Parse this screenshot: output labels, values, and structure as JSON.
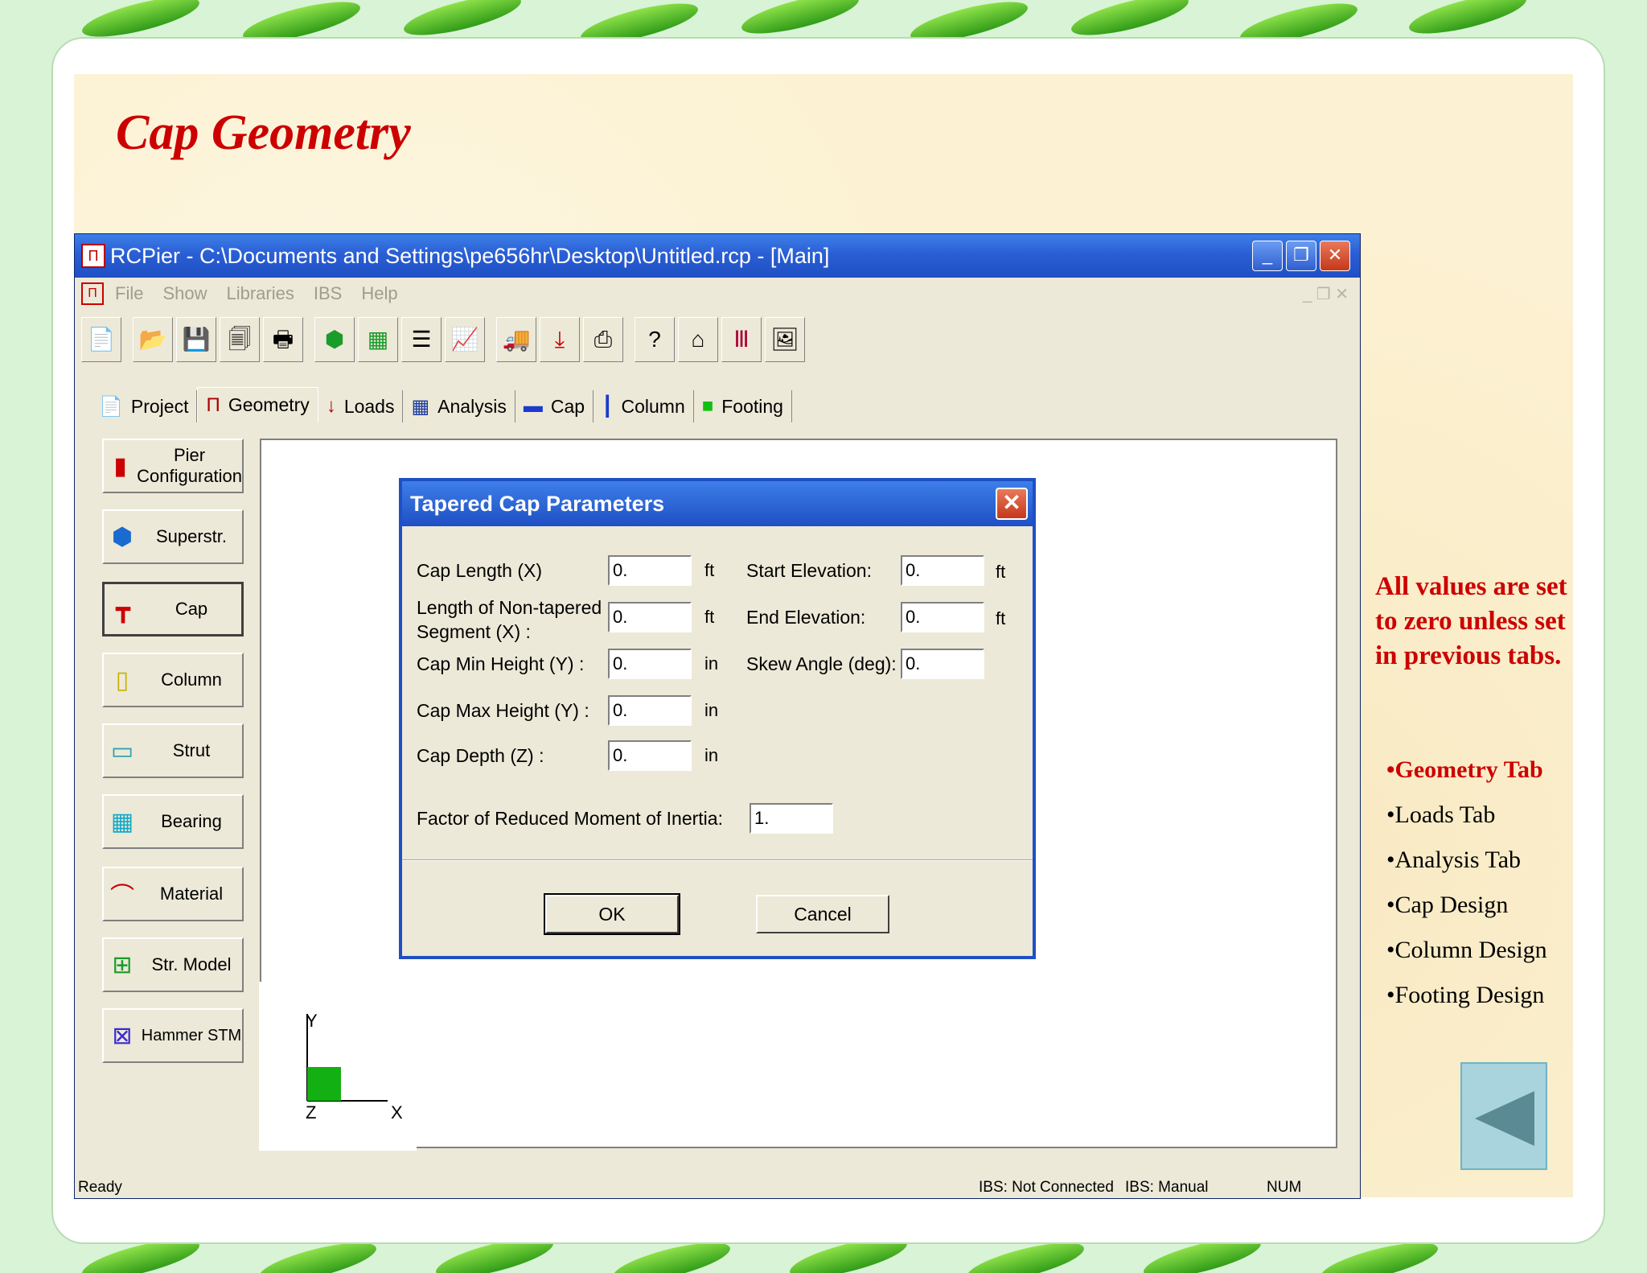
{
  "slide": {
    "title": "Cap Geometry",
    "notes": "All values are set to zero unless set in previous tabs.",
    "bullets": [
      {
        "label": "•Geometry Tab",
        "active": true
      },
      {
        "label": "•Loads Tab",
        "active": false
      },
      {
        "label": "•Analysis Tab",
        "active": false
      },
      {
        "label": "•Cap Design",
        "active": false
      },
      {
        "label": "•Column Design",
        "active": false
      },
      {
        "label": "•Footing Design",
        "active": false
      }
    ]
  },
  "window": {
    "title": "RCPier - C:\\Documents and Settings\\pe656hr\\Desktop\\Untitled.rcp - [Main]",
    "menu": [
      "File",
      "Show",
      "Libraries",
      "IBS",
      "Help"
    ],
    "tabs": [
      {
        "label": "Project",
        "icon": "doc-icon"
      },
      {
        "label": "Geometry",
        "icon": "frame-icon"
      },
      {
        "label": "Loads",
        "icon": "arrow-down-icon"
      },
      {
        "label": "Analysis",
        "icon": "grid-icon"
      },
      {
        "label": "Cap",
        "icon": "cap-bar-icon"
      },
      {
        "label": "Column",
        "icon": "column-icon"
      },
      {
        "label": "Footing",
        "icon": "footing-icon"
      }
    ],
    "sidebar": [
      {
        "label": "Pier Configuration",
        "icon": "pier-config-icon"
      },
      {
        "label": "Superstr.",
        "icon": "superstructure-icon"
      },
      {
        "label": "Cap",
        "icon": "hammer-icon"
      },
      {
        "label": "Column",
        "icon": "column-icon"
      },
      {
        "label": "Strut",
        "icon": "strut-icon"
      },
      {
        "label": "Bearing",
        "icon": "bearing-icon"
      },
      {
        "label": "Material",
        "icon": "material-curve-icon"
      },
      {
        "label": "Str. Model",
        "icon": "str-model-icon"
      },
      {
        "label": "Hammer STM",
        "icon": "hammer-stm-icon"
      }
    ],
    "status": {
      "left": "Ready",
      "ibs_conn": "IBS: Not Connected",
      "ibs_mode": "IBS: Manual",
      "num": "NUM"
    },
    "axes": {
      "y": "Y",
      "z": "Z",
      "x": "X"
    }
  },
  "dialog": {
    "title": "Tapered Cap Parameters",
    "fields": {
      "cap_length": {
        "label": "Cap Length (X)",
        "value": "0.",
        "unit": "ft"
      },
      "non_tapered": {
        "label1": "Length of Non-tapered",
        "label2": "Segment (X) :",
        "value": "0.",
        "unit": "ft"
      },
      "min_height": {
        "label": "Cap Min Height (Y) :",
        "value": "0.",
        "unit": "in"
      },
      "max_height": {
        "label": "Cap Max Height (Y) :",
        "value": "0.",
        "unit": "in"
      },
      "depth": {
        "label": "Cap Depth (Z) :",
        "value": "0.",
        "unit": "in"
      },
      "start_elev": {
        "label": "Start Elevation:",
        "value": "0.",
        "unit": "ft"
      },
      "end_elev": {
        "label": "End Elevation:",
        "value": "0.",
        "unit": "ft"
      },
      "skew": {
        "label": "Skew Angle (deg):",
        "value": "0."
      },
      "factor": {
        "label": "Factor of Reduced Moment of Inertia:",
        "value": "1."
      }
    },
    "ok_label": "OK",
    "cancel_label": "Cancel"
  }
}
